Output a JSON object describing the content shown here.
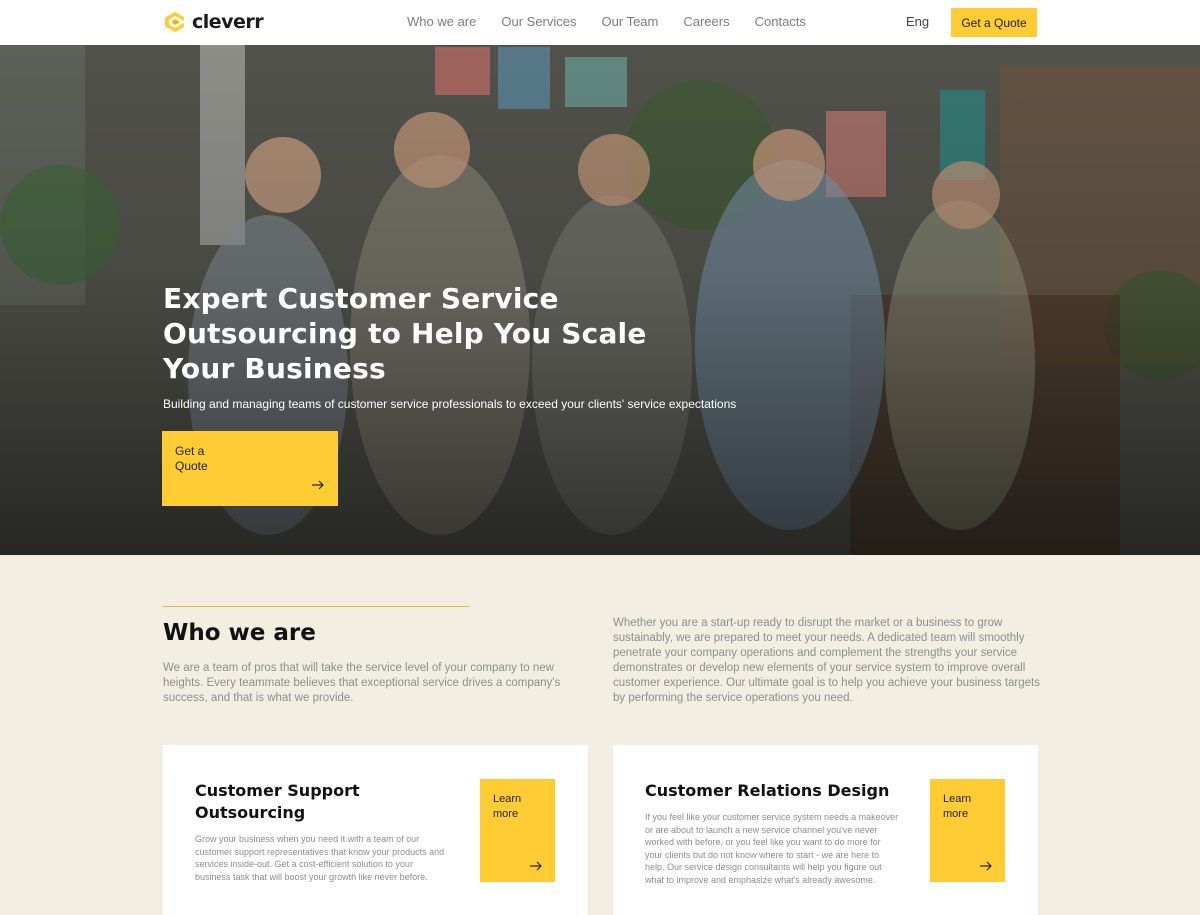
{
  "brand": {
    "name": "cleverr",
    "accent": "#ffcc33"
  },
  "nav": {
    "items": [
      "Who we are",
      "Our Services",
      "Our Team",
      "Careers",
      "Contacts"
    ]
  },
  "header": {
    "lang": "Eng",
    "cta_label": "Get a Quote"
  },
  "hero": {
    "title": "Expert Customer Service Outsourcing to Help You Scale Your Business",
    "subtitle": "Building and managing teams of customer service professionals to exceed your clients' service expectations",
    "cta_label": "Get a Quote"
  },
  "who": {
    "title": "Who we are",
    "left_text": "We are a team of pros that will take the service level of your company to new heights. Every teammate believes that exceptional service drives a company's success, and that is what we provide.",
    "right_text": "Whether you are a start-up ready to disrupt the market or a business to grow sustainably, we are prepared to meet your needs. A dedicated team will smoothly penetrate your company operations and complement the strengths your service demonstrates or develop new elements of your service system to improve overall customer experience. Our ultimate goal is to help you achieve your business targets by performing the service operations you need."
  },
  "cards": [
    {
      "title": "Customer Support Outsourcing",
      "text": "Grow your business when you need it with a team of our customer support representatives that know your products and services inside-out. Get a cost-efficient solution to your business task that will boost your growth like never before.",
      "button_label": "Learn more"
    },
    {
      "title": "Customer Relations Design",
      "text": "If you feel like your customer service system needs a makeover or are about to launch a new service channel you've never worked with before, or you feel like you want to do more for your clients but do not know where to start - we are here to help. Our service design consultants will help you figure out what to improve and emphasize what's already awesome.",
      "button_label": "Learn more"
    }
  ],
  "icons": {
    "logo": "cleverr-logo-icon",
    "arrow": "arrow-right-icon"
  }
}
